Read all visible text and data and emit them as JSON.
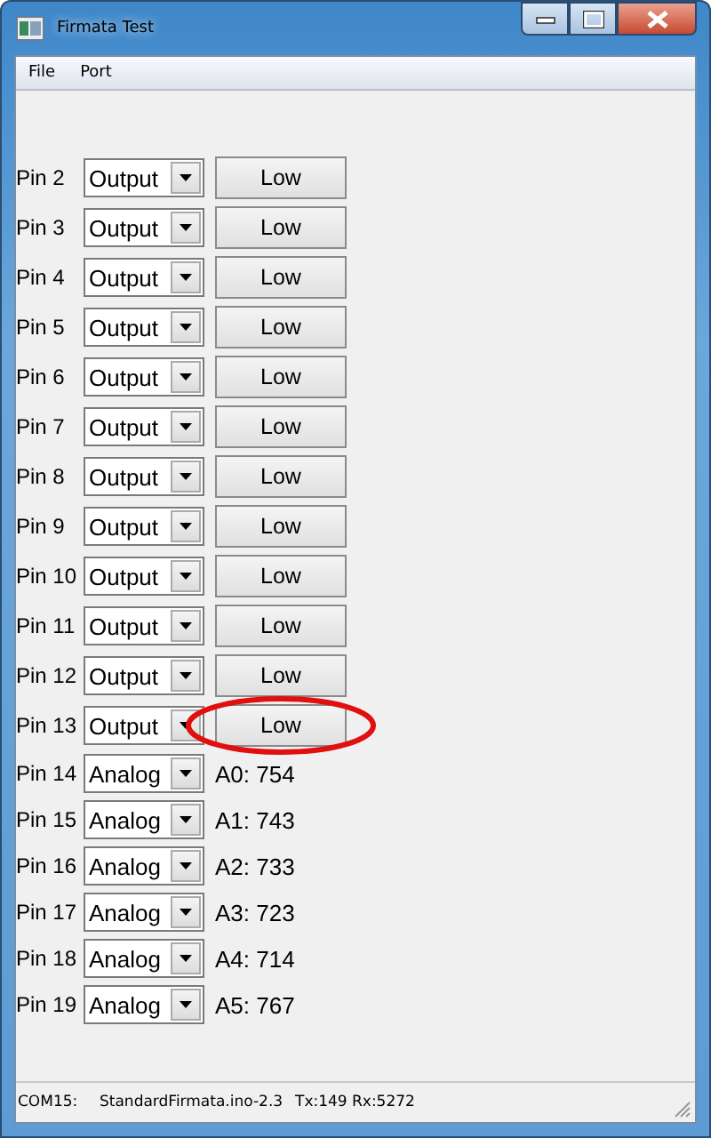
{
  "window": {
    "title": "Firmata Test"
  },
  "menu": [
    {
      "label": "File"
    },
    {
      "label": "Port"
    }
  ],
  "pins": [
    {
      "kind": "output",
      "label": "Pin 2",
      "mode": "Output",
      "button": "Low",
      "circled": false
    },
    {
      "kind": "output",
      "label": "Pin 3",
      "mode": "Output",
      "button": "Low",
      "circled": false
    },
    {
      "kind": "output",
      "label": "Pin 4",
      "mode": "Output",
      "button": "Low",
      "circled": false
    },
    {
      "kind": "output",
      "label": "Pin 5",
      "mode": "Output",
      "button": "Low",
      "circled": false
    },
    {
      "kind": "output",
      "label": "Pin 6",
      "mode": "Output",
      "button": "Low",
      "circled": false
    },
    {
      "kind": "output",
      "label": "Pin 7",
      "mode": "Output",
      "button": "Low",
      "circled": false
    },
    {
      "kind": "output",
      "label": "Pin 8",
      "mode": "Output",
      "button": "Low",
      "circled": false
    },
    {
      "kind": "output",
      "label": "Pin 9",
      "mode": "Output",
      "button": "Low",
      "circled": false
    },
    {
      "kind": "output",
      "label": "Pin 10",
      "mode": "Output",
      "button": "Low",
      "circled": false
    },
    {
      "kind": "output",
      "label": "Pin 11",
      "mode": "Output",
      "button": "Low",
      "circled": false
    },
    {
      "kind": "output",
      "label": "Pin 12",
      "mode": "Output",
      "button": "Low",
      "circled": false
    },
    {
      "kind": "output",
      "label": "Pin 13",
      "mode": "Output",
      "button": "Low",
      "circled": true
    },
    {
      "kind": "analog",
      "label": "Pin 14",
      "mode": "Analog",
      "reading": "A0: 754"
    },
    {
      "kind": "analog",
      "label": "Pin 15",
      "mode": "Analog",
      "reading": "A1: 743"
    },
    {
      "kind": "analog",
      "label": "Pin 16",
      "mode": "Analog",
      "reading": "A2: 733"
    },
    {
      "kind": "analog",
      "label": "Pin 17",
      "mode": "Analog",
      "reading": "A3: 723"
    },
    {
      "kind": "analog",
      "label": "Pin 18",
      "mode": "Analog",
      "reading": "A4: 714"
    },
    {
      "kind": "analog",
      "label": "Pin 19",
      "mode": "Analog",
      "reading": "A5: 767"
    }
  ],
  "status_bar": {
    "port": "COM15:",
    "firmware": "StandardFirmata.ino-2.3",
    "traffic": "Tx:149 Rx:5272"
  }
}
